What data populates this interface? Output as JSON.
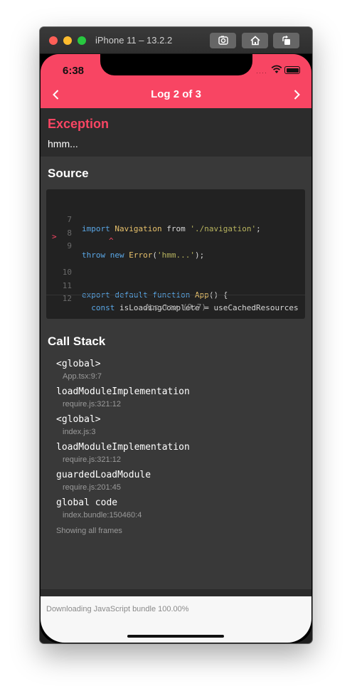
{
  "window": {
    "title": "iPhone 11 – 13.2.2"
  },
  "toolbar": {
    "screenshot_icon": "camera-icon",
    "home_icon": "home-icon",
    "rotate_icon": "rotate-icon"
  },
  "status": {
    "time": "6:38",
    "signal": "····"
  },
  "nav": {
    "title": "Log 2 of 3",
    "prev_icon": "chevron-left-icon",
    "next_icon": "chevron-right-icon"
  },
  "exception": {
    "title": "Exception",
    "message": "hmm..."
  },
  "source": {
    "heading": "Source",
    "lines": [
      {
        "number": "7",
        "marker": ""
      },
      {
        "number": "8",
        "marker": ""
      },
      {
        "number": "9",
        "marker": ">"
      },
      {
        "number": "10",
        "marker": ""
      },
      {
        "number": "11",
        "marker": ""
      },
      {
        "number": "12",
        "marker": ""
      }
    ],
    "code": {
      "l7": {
        "k1": "import",
        "id1": "Navigation",
        "k2": "from",
        "s1": "'./navigation'",
        "t1": ";"
      },
      "l9": {
        "k1": "throw",
        "k2": "new",
        "id1": "Error",
        "t1": "(",
        "s1": "'hmm...'",
        "t2": ");"
      },
      "l11": {
        "k1": "export",
        "k2": "default",
        "k3": "function",
        "id1": "App",
        "t1": "() {"
      },
      "l12": {
        "k1": "const",
        "t1": "isLoadingComplete = useCachedResources"
      }
    },
    "caret": "^",
    "file": "App.tsx (9:7)"
  },
  "call_stack": {
    "heading": "Call Stack",
    "frames": [
      {
        "fn": "<global>",
        "file": "App.tsx:9:7"
      },
      {
        "fn": "loadModuleImplementation",
        "file": "require.js:321:12"
      },
      {
        "fn": "<global>",
        "file": "index.js:3"
      },
      {
        "fn": "loadModuleImplementation",
        "file": "require.js:321:12"
      },
      {
        "fn": "guardedLoadModule",
        "file": "require.js:201:45"
      },
      {
        "fn": "global code",
        "file": "index.bundle:150460:4"
      }
    ],
    "footer": "Showing all frames"
  },
  "bottom": {
    "download": "Downloading JavaScript bundle 100.00%"
  },
  "colors": {
    "accent": "#f84563",
    "panel": "#393939",
    "code_bg": "#222222"
  }
}
